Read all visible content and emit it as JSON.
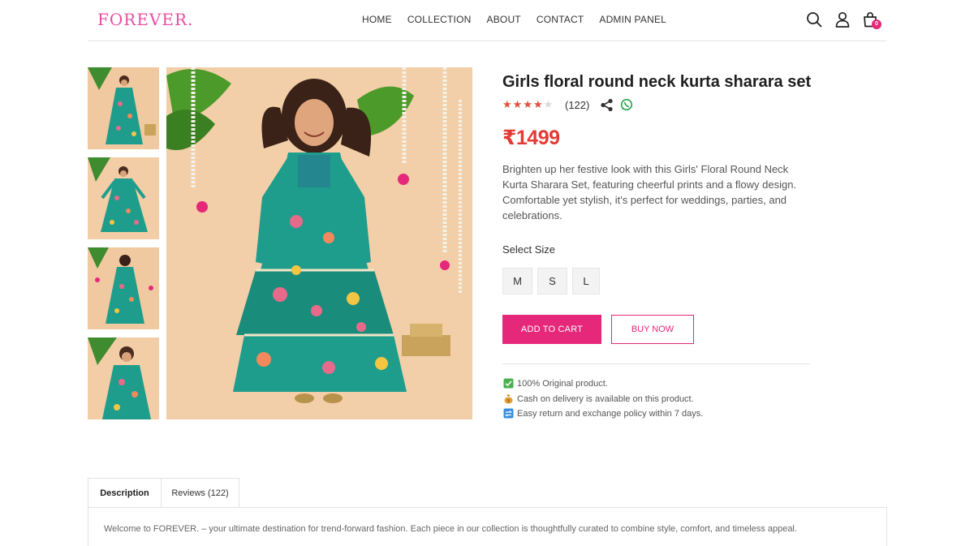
{
  "header": {
    "logo": "FOREVER.",
    "nav": [
      "HOME",
      "COLLECTION",
      "ABOUT",
      "CONTACT",
      "ADMIN PANEL"
    ],
    "cart_count": "0",
    "icons": [
      "search-icon",
      "user-icon",
      "shopping-bag-icon"
    ]
  },
  "gallery": {
    "thumbnail_count": 4,
    "main_image": "girl-in-teal-floral-kurta-sharara-photo"
  },
  "product": {
    "title": "Girls floral round neck kurta sharara set",
    "rating": 4,
    "rating_max": 5,
    "review_count": "(122)",
    "price": "₹1499",
    "description": "Brighten up her festive look with this Girls' Floral Round Neck Kurta Sharara Set, featuring cheerful prints and a flowy design. Comfortable yet stylish, it's perfect for weddings, parties, and celebrations.",
    "select_size_label": "Select Size",
    "sizes": [
      "M",
      "S",
      "L"
    ],
    "add_to_cart_label": "ADD TO CART",
    "buy_now_label": "BUY NOW",
    "features": [
      "100% Original product.",
      "Cash on delivery is available on this product.",
      "Easy return and exchange policy within 7 days."
    ]
  },
  "tabs": {
    "items": [
      "Description",
      "Reviews (122)"
    ],
    "active": "Description",
    "description_text": "Welcome to FOREVER. – your ultimate destination for trend-forward fashion. Each piece in our collection is thoughtfully curated to combine style, comfort, and timeless appeal."
  },
  "colors": {
    "brand_pink": "#e6287a",
    "price_red": "#e53935",
    "star_red": "#e74c3c",
    "star_empty": "#d9d9d9",
    "dress_teal": "#1f9d8c"
  }
}
